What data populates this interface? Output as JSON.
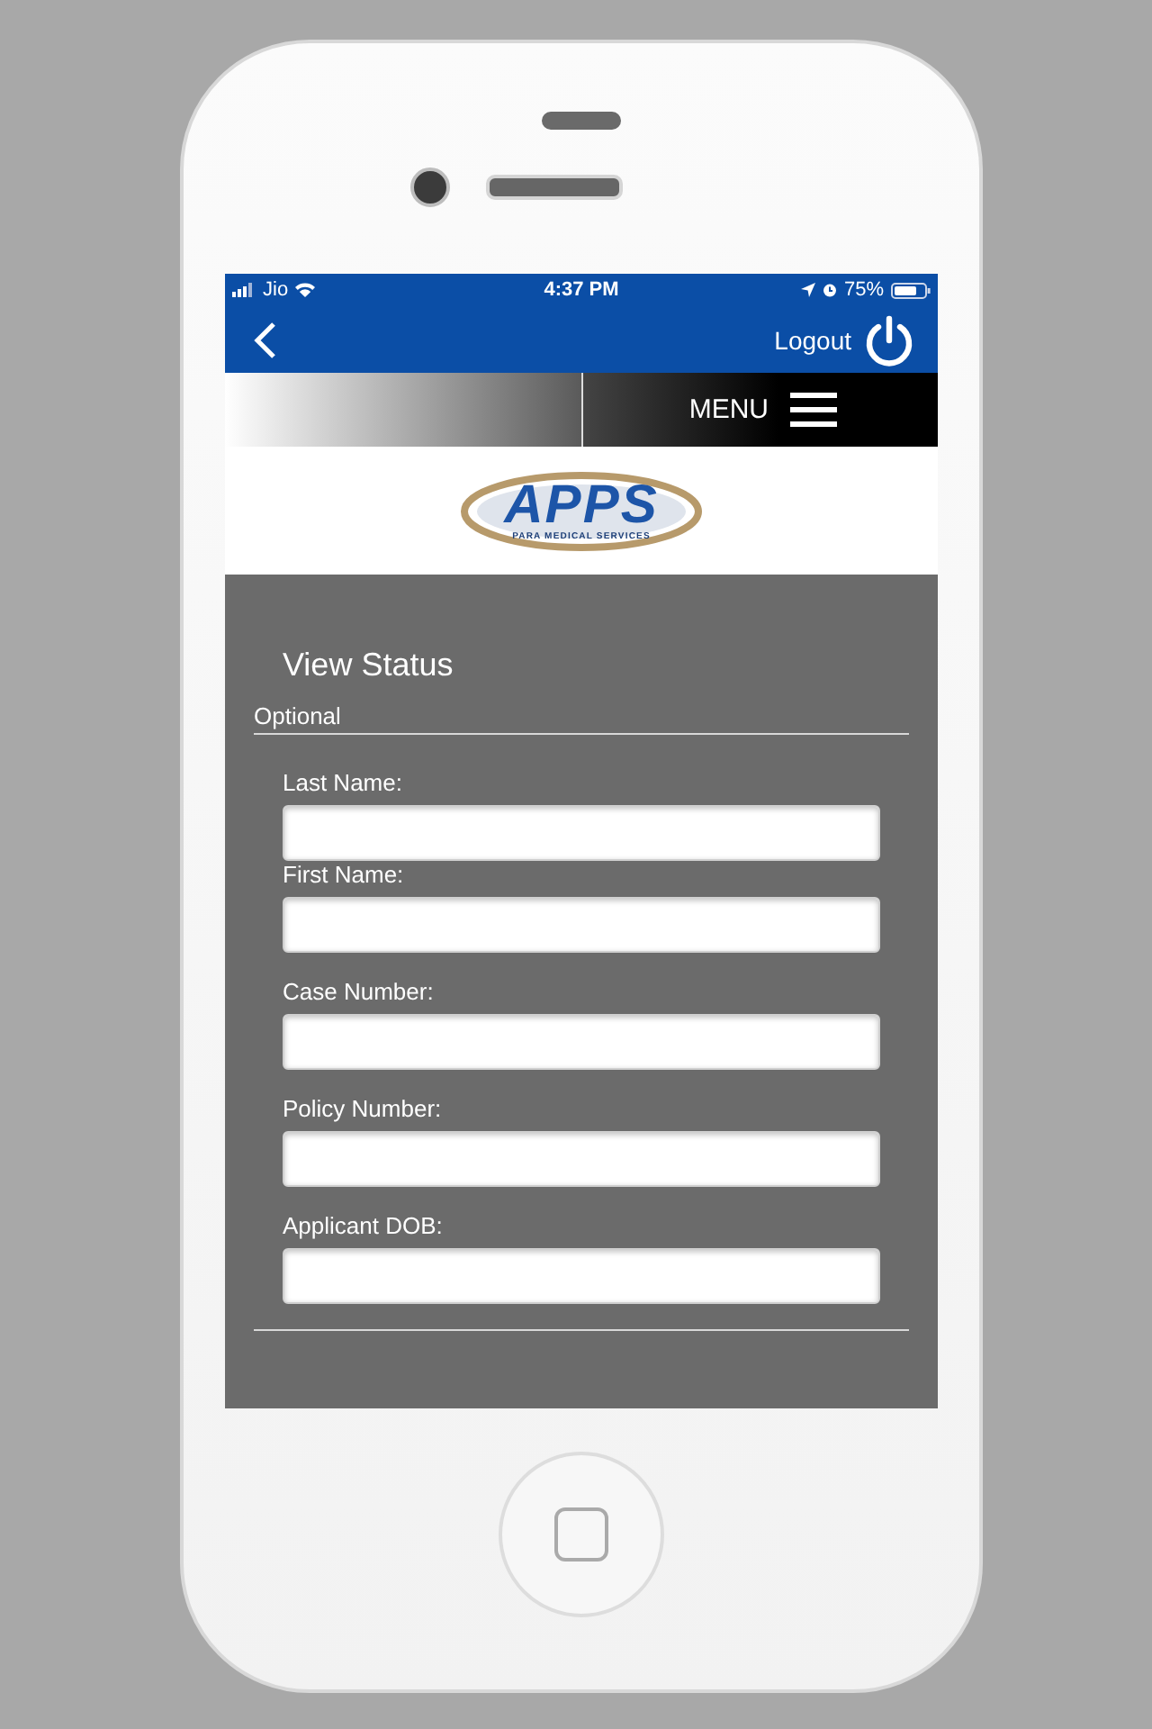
{
  "status_bar": {
    "carrier": "Jio",
    "time": "4:37 PM",
    "battery": "75%"
  },
  "header": {
    "logout": "Logout"
  },
  "menu": {
    "label": "MENU"
  },
  "logo": {
    "name": "APPS",
    "tagline": "PARA MEDICAL SERVICES"
  },
  "form": {
    "title": "View Status",
    "section": "Optional",
    "fields": [
      {
        "label": "Last Name:"
      },
      {
        "label": "First Name:"
      },
      {
        "label": "Case Number:"
      },
      {
        "label": "Policy Number:"
      },
      {
        "label": "Applicant DOB:"
      }
    ]
  }
}
